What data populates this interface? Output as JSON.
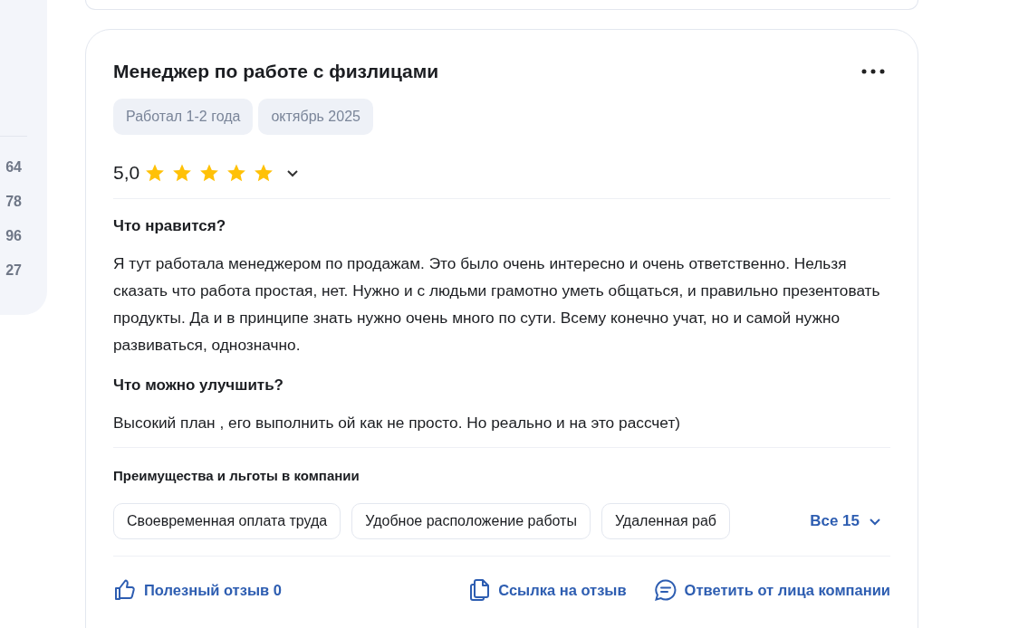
{
  "sidebar": {
    "stats": [
      "64",
      "78",
      "96",
      "27"
    ]
  },
  "review": {
    "title": "Менеджер по работе с физлицами",
    "tags": [
      "Работал 1-2 года",
      "октябрь 2025"
    ],
    "rating": {
      "value": "5,0",
      "stars": 5
    },
    "sections": [
      {
        "heading": "Что нравится?",
        "text": "Я тут работала менеджером по продажам. Это было очень интересно и очень ответственно. Нельзя сказать что работа простая, нет. Нужно и с людьми грамотно уметь общаться, и правильно презентовать продукты. Да и в принципе знать нужно очень много по сути. Всему конечно учат, но и самой нужно развиваться, однозначно."
      },
      {
        "heading": "Что можно улучшить?",
        "text": "Высокий план , его выполнить ой как не просто. Но реально и на это рассчет)"
      }
    ],
    "benefits": {
      "heading": "Преимущества и льготы в компании",
      "items": [
        "Своевременная оплата труда",
        "Удобное расположение работы",
        "Удаленная раб"
      ],
      "more": "Все 15"
    },
    "actions": [
      {
        "kind": "like",
        "label": "Полезный отзыв 0"
      },
      {
        "kind": "link",
        "label": "Ссылка на отзыв"
      },
      {
        "kind": "reply",
        "label": "Ответить от лица компании"
      }
    ]
  }
}
